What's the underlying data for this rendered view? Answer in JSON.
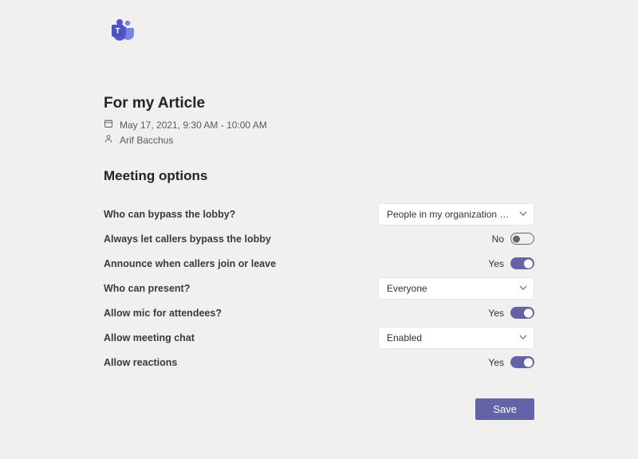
{
  "header": {
    "meeting_title": "For my Article",
    "datetime": "May 17, 2021, 9:30 AM - 10:00 AM",
    "organizer": "Arif Bacchus"
  },
  "section_title": "Meeting options",
  "options": {
    "bypass_lobby": {
      "label": "Who can bypass the lobby?",
      "value": "People in my organization and gu..."
    },
    "callers_bypass": {
      "label": "Always let callers bypass the lobby",
      "state_text": "No",
      "on": false
    },
    "announce": {
      "label": "Announce when callers join or leave",
      "state_text": "Yes",
      "on": true
    },
    "who_present": {
      "label": "Who can present?",
      "value": "Everyone"
    },
    "allow_mic": {
      "label": "Allow mic for attendees?",
      "state_text": "Yes",
      "on": true
    },
    "meeting_chat": {
      "label": "Allow meeting chat",
      "value": "Enabled"
    },
    "allow_reactions": {
      "label": "Allow reactions",
      "state_text": "Yes",
      "on": true
    }
  },
  "buttons": {
    "save": "Save"
  }
}
